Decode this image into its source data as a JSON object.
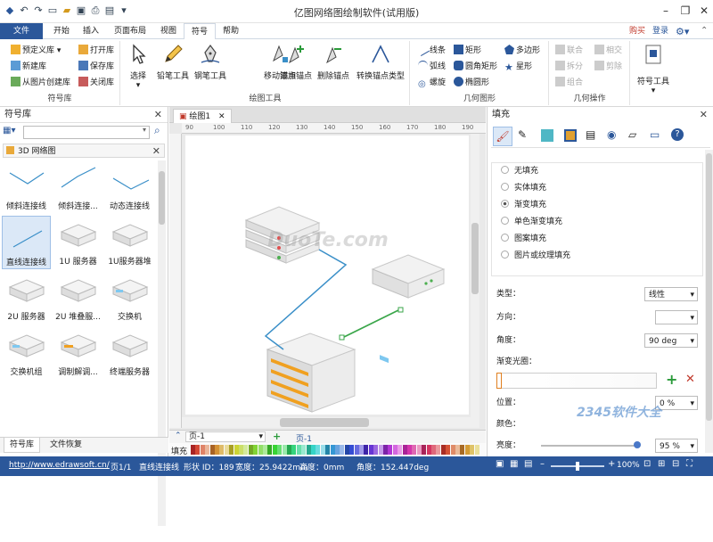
{
  "titlebar": {
    "title": "亿图网络图绘制软件(试用版)"
  },
  "tabs": [
    {
      "label": "文件"
    },
    {
      "label": "开始"
    },
    {
      "label": "插入"
    },
    {
      "label": "页面布局"
    },
    {
      "label": "视图"
    },
    {
      "label": "符号"
    },
    {
      "label": "帮助"
    }
  ],
  "topright": {
    "buy": "购买",
    "login": "登录"
  },
  "ribbon": {
    "library_group": {
      "label": "符号库",
      "items": [
        "预定义库",
        "打开库",
        "新建库",
        "保存库",
        "从图片创建库",
        "关闭库"
      ]
    },
    "drawing_group": {
      "label": "绘图工具",
      "buttons": [
        "选择",
        "铅笔工具",
        "钢笔工具",
        "移动锚点",
        "添加锚点",
        "删除锚点",
        "转换锚点类型"
      ]
    },
    "geometry_group": {
      "label": "几何图形",
      "items": [
        "线条",
        "矩形",
        "多边形",
        "弧线",
        "圆角矩形",
        "星形",
        "螺旋",
        "椭圆形"
      ]
    },
    "geo_ops_group": {
      "label": "几何操作",
      "items": [
        "联合",
        "相交",
        "拆分",
        "剪除",
        "组合"
      ]
    },
    "symbol_tool": {
      "label": "符号工具"
    }
  },
  "leftpanel": {
    "title": "符号库",
    "search_placeholder": "",
    "library_name": "3D 网络图",
    "shapes": [
      "倾斜连接线",
      "倾斜连接...",
      "动态连接线",
      "直线连接线",
      "1U 服务器",
      "1U服务器堆",
      "2U 服务器",
      "2U 堆叠服...",
      "交换机",
      "交换机组",
      "调制解调...",
      "终端服务器"
    ],
    "bottom_tabs": [
      "符号库",
      "文件恢复"
    ]
  },
  "canvas": {
    "doc_tab": "绘图1",
    "ruler_labels": [
      "90",
      "100",
      "110",
      "120",
      "130",
      "140",
      "150",
      "160",
      "170",
      "180",
      "190"
    ],
    "page_selector": "页-1",
    "page_tab": "页-1",
    "fill_label": "填充",
    "watermark": "DuoTe.com"
  },
  "rightpanel": {
    "title": "填充",
    "fill_options": [
      "无填充",
      "实体填充",
      "渐变填充",
      "单色渐变填充",
      "图案填充",
      "图片或纹理填充"
    ],
    "selected_option": "渐变填充",
    "type_label": "类型：",
    "type_value": "线性",
    "direction_label": "方向：",
    "angle_label": "角度：",
    "angle_value": "90 deg",
    "gradient_label": "渐变光圈：",
    "position_label": "位置：",
    "position_value": "0 %",
    "color_label": "颜色：",
    "brightness_label": "亮度：",
    "brightness_value": "95 %",
    "watermark": "2345软件大全"
  },
  "statusbar": {
    "url": "http://www.edrawsoft.cn/",
    "page": "页1/1",
    "shape_name": "直线连接线",
    "shape_id": "形状 ID：189",
    "width": "宽度：25.9422mm",
    "height": "高度：0mm",
    "angle": "角度：152.447deg",
    "zoom": "100%"
  },
  "colors": {
    "accent": "#2b579a",
    "connector_blue": "#3a8fc8",
    "connector_green": "#3aa64a"
  }
}
